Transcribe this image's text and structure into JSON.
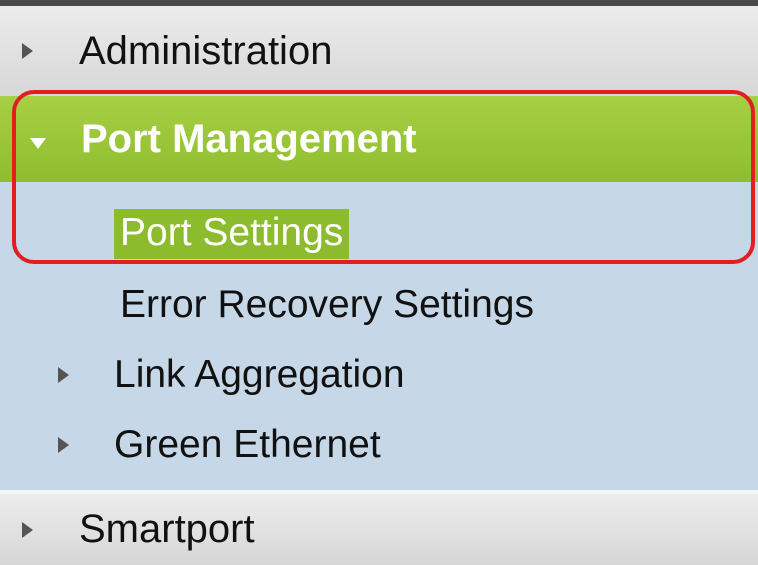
{
  "nav": {
    "administration": "Administration",
    "port_management": "Port Management",
    "submenu": [
      {
        "label": "Port Settings"
      },
      {
        "label": "Error Recovery Settings"
      },
      {
        "label": "Link Aggregation"
      },
      {
        "label": "Green Ethernet"
      }
    ],
    "smartport": "Smartport"
  },
  "colors": {
    "active_green": "#8dbb2e",
    "submenu_bg": "#c6d7e8",
    "highlight_red": "#e02020"
  }
}
